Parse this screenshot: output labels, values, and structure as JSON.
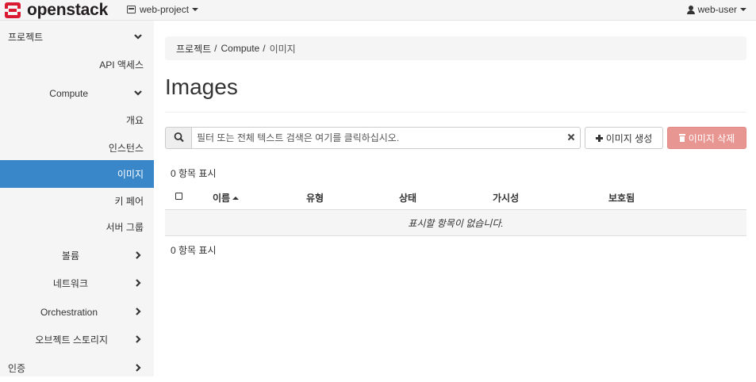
{
  "navbar": {
    "brand": "openstack",
    "project": "web-project",
    "user": "web-user"
  },
  "sidebar": {
    "items": [
      {
        "label": "프로젝트",
        "chevron": "down"
      },
      {
        "label": "API 액세스"
      },
      {
        "label": "Compute",
        "chevron": "down"
      },
      {
        "label": "개요"
      },
      {
        "label": "인스턴스"
      },
      {
        "label": "이미지",
        "active": true
      },
      {
        "label": "키 페어"
      },
      {
        "label": "서버 그룹"
      },
      {
        "label": "볼륨",
        "chevron": "right"
      },
      {
        "label": "네트워크",
        "chevron": "right"
      },
      {
        "label": "Orchestration",
        "chevron": "right"
      },
      {
        "label": "오브젝트 스토리지",
        "chevron": "right"
      },
      {
        "label": "인증",
        "chevron": "right"
      }
    ]
  },
  "breadcrumb": {
    "items": [
      "프로젝트",
      "Compute"
    ],
    "current": "이미지"
  },
  "page_title": "Images",
  "search": {
    "placeholder": "필터 또는 전체 텍스트 검색은 여기를 클릭하십시오."
  },
  "buttons": {
    "create": "이미지 생성",
    "delete": "이미지 삭제"
  },
  "table": {
    "count_top": "0 항목 표시",
    "count_bottom": "0 항목 표시",
    "columns": [
      "이름",
      "유형",
      "상태",
      "가시성",
      "보호됨"
    ],
    "empty_message": "표시할 항목이 없습니다."
  },
  "colors": {
    "brand_red": "#da1a32",
    "active_blue": "#3987c8",
    "danger_disabled": "#e89691"
  }
}
